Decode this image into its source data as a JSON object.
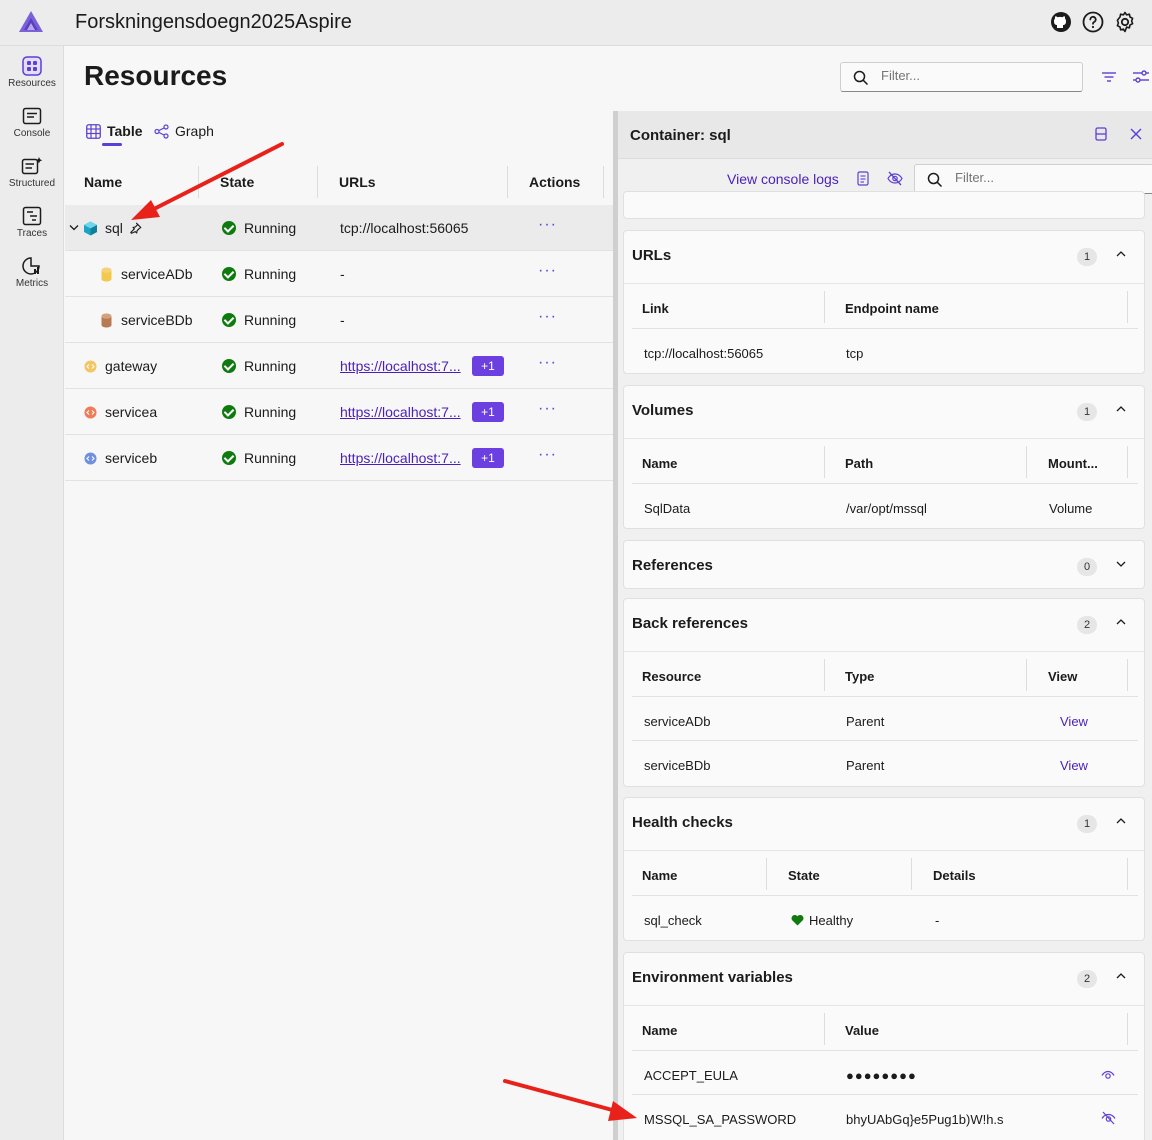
{
  "app": {
    "title": "Forskningensdoegn2025Aspire",
    "accent": "#5d3fd3"
  },
  "header": {
    "icons": [
      "github-icon",
      "help-icon",
      "settings-icon"
    ]
  },
  "nav": {
    "items": [
      {
        "label": "Resources",
        "icon": "resources-icon",
        "active": true
      },
      {
        "label": "Console",
        "icon": "console-icon"
      },
      {
        "label": "Structured",
        "icon": "structured-logs-icon"
      },
      {
        "label": "Traces",
        "icon": "traces-icon"
      },
      {
        "label": "Metrics",
        "icon": "metrics-icon"
      }
    ]
  },
  "main": {
    "title": "Resources",
    "search_placeholder": "Filter...",
    "tabs": [
      {
        "label": "Table",
        "icon": "table-icon",
        "selected": true
      },
      {
        "label": "Graph",
        "icon": "graph-icon"
      }
    ],
    "columns": [
      "Name",
      "State",
      "URLs",
      "Actions"
    ],
    "rows": [
      {
        "name": "sql",
        "state": "Running",
        "url": "tcp://localhost:56065",
        "badge": "",
        "expanded": true,
        "pinned": true
      },
      {
        "name": "serviceADb",
        "state": "Running",
        "url": "-",
        "badge": ""
      },
      {
        "name": "serviceBDb",
        "state": "Running",
        "url": "-",
        "badge": ""
      },
      {
        "name": "gateway",
        "state": "Running",
        "url": "https://localhost:7...",
        "badge": "+1"
      },
      {
        "name": "servicea",
        "state": "Running",
        "url": "https://localhost:7...",
        "badge": "+1"
      },
      {
        "name": "serviceb",
        "state": "Running",
        "url": "https://localhost:7...",
        "badge": "+1"
      }
    ],
    "actions_label": "···"
  },
  "panel": {
    "title": "Container: sql",
    "console_link": "View console logs",
    "filter_placeholder": "Filter...",
    "sections": {
      "urls": {
        "title": "URLs",
        "count": "1",
        "headers": [
          "Link",
          "Endpoint name"
        ],
        "rows": [
          [
            "tcp://localhost:56065",
            "tcp"
          ]
        ]
      },
      "volumes": {
        "title": "Volumes",
        "count": "1",
        "headers": [
          "Name",
          "Path",
          "Mount..."
        ],
        "rows": [
          [
            "SqlData",
            "/var/opt/mssql",
            "Volume"
          ]
        ]
      },
      "references": {
        "title": "References",
        "count": "0"
      },
      "back_references": {
        "title": "Back references",
        "count": "2",
        "headers": [
          "Resource",
          "Type",
          "View"
        ],
        "rows": [
          [
            "serviceADb",
            "Parent",
            "View"
          ],
          [
            "serviceBDb",
            "Parent",
            "View"
          ]
        ]
      },
      "health": {
        "title": "Health checks",
        "count": "1",
        "headers": [
          "Name",
          "State",
          "Details"
        ],
        "rows": [
          [
            "sql_check",
            "Healthy",
            "-"
          ]
        ]
      },
      "env": {
        "title": "Environment variables",
        "count": "2",
        "headers": [
          "Name",
          "Value"
        ],
        "rows": [
          [
            "ACCEPT_EULA",
            "●●●●●●●●"
          ],
          [
            "MSSQL_SA_PASSWORD",
            "bhyUAbGq}e5Pug1b)W!h.s"
          ]
        ]
      }
    }
  }
}
